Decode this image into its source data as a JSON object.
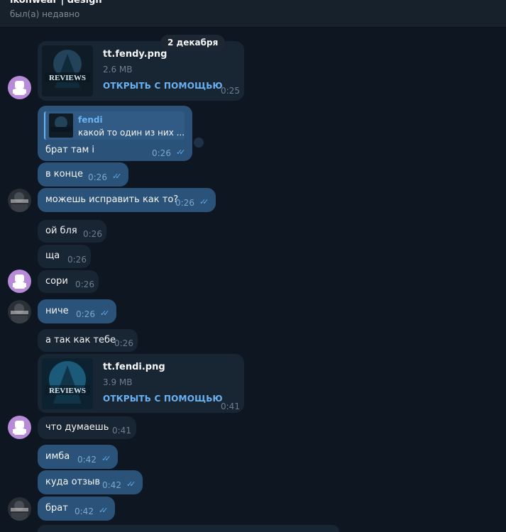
{
  "header": {
    "title": "ikonwear | design",
    "status": "был(а) недавно"
  },
  "date_label": "2 декабря",
  "file_open_label": "ОТКРЫТЬ С ПОМОЩЬЮ",
  "thumb_caption": "REVIEWS",
  "messages": [
    {
      "kind": "file",
      "file_name": "tt.fendy.png",
      "size": "2.6 MB",
      "time": "0:25",
      "direction": "in"
    },
    {
      "kind": "reply",
      "reply_name": "fendi",
      "reply_text": "какой то один из них ...",
      "text": "брат там i",
      "time": "0:26",
      "direction": "out",
      "read": true
    },
    {
      "text": "в конце",
      "time": "0:26",
      "direction": "out",
      "read": true
    },
    {
      "text": "можешь исправить как то?",
      "time": "0:26",
      "direction": "out",
      "read": true
    },
    {
      "text": "ой бля",
      "time": "0:26",
      "direction": "in"
    },
    {
      "text": "ща",
      "time": "0:26",
      "direction": "in"
    },
    {
      "text": "сори",
      "time": "0:26",
      "direction": "in"
    },
    {
      "text": "ниче",
      "time": "0:26",
      "direction": "out",
      "read": true
    },
    {
      "text": "а так как тебе",
      "time": "0:26",
      "direction": "in"
    },
    {
      "kind": "file",
      "file_name": "tt.fendi.png",
      "size": "3.9 MB",
      "time": "0:41",
      "direction": "in"
    },
    {
      "text": "что думаешь",
      "time": "0:41",
      "direction": "in"
    },
    {
      "text": "имба",
      "time": "0:42",
      "direction": "out",
      "read": true
    },
    {
      "text": "куда отзыв",
      "time": "0:42",
      "direction": "out",
      "read": true
    },
    {
      "text": "брат",
      "time": "0:42",
      "direction": "out",
      "read": true
    }
  ],
  "colors": {
    "bg": "#0e1621",
    "incoming": "#182533",
    "outgoing": "#2b5278",
    "accent": "#6ab2f2",
    "avatar_pink": "#b88bd8"
  }
}
